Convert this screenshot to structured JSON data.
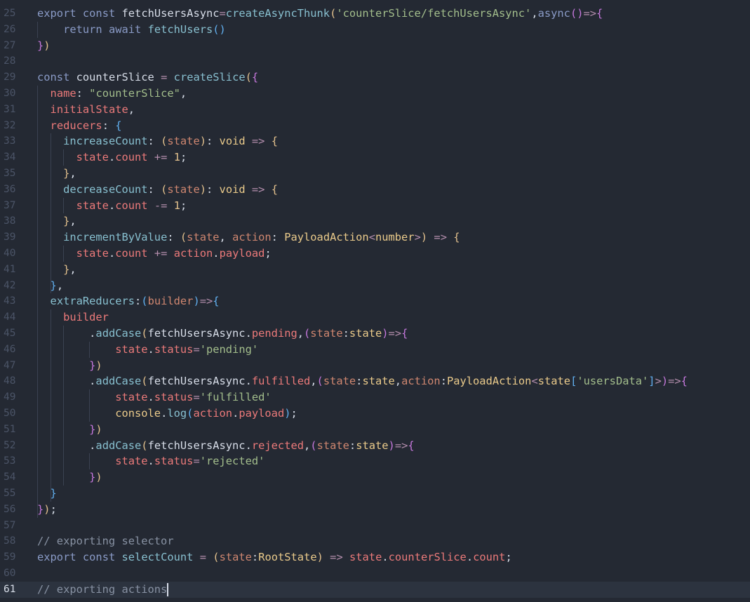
{
  "editor": {
    "current_line": 61,
    "lines": [
      {
        "n": "25",
        "tokens": [
          [
            "kw",
            "export"
          ],
          [
            "pu",
            " "
          ],
          [
            "kw",
            "const"
          ],
          [
            "pu",
            " "
          ],
          [
            "id",
            "fetchUsersAsync"
          ],
          [
            "op",
            "="
          ],
          [
            "fn",
            "createAsyncThunk"
          ],
          [
            "b1",
            "("
          ],
          [
            "st",
            "'counterSlice/fetchUsersAsync'"
          ],
          [
            "pu",
            ","
          ],
          [
            "kw",
            "async"
          ],
          [
            "b2",
            "()"
          ],
          [
            "op",
            "=>"
          ],
          [
            "b2",
            "{"
          ]
        ]
      },
      {
        "n": "26",
        "tokens": [
          [
            "pu",
            "    "
          ],
          [
            "kw",
            "return"
          ],
          [
            "pu",
            " "
          ],
          [
            "kw",
            "await"
          ],
          [
            "pu",
            " "
          ],
          [
            "fn",
            "fetchUsers"
          ],
          [
            "b3",
            "()"
          ]
        ]
      },
      {
        "n": "27",
        "tokens": [
          [
            "b2",
            "}"
          ],
          [
            "b1",
            ")"
          ]
        ]
      },
      {
        "n": "28",
        "tokens": []
      },
      {
        "n": "29",
        "tokens": [
          [
            "kw",
            "const"
          ],
          [
            "pu",
            " "
          ],
          [
            "id",
            "counterSlice"
          ],
          [
            "pu",
            " "
          ],
          [
            "op",
            "="
          ],
          [
            "pu",
            " "
          ],
          [
            "fn",
            "createSlice"
          ],
          [
            "b1",
            "("
          ],
          [
            "b2",
            "{"
          ]
        ]
      },
      {
        "n": "30",
        "tokens": [
          [
            "pu",
            "  "
          ],
          [
            "pr",
            "name"
          ],
          [
            "pu",
            ": "
          ],
          [
            "st",
            "\"counterSlice\""
          ],
          [
            "pu",
            ","
          ]
        ]
      },
      {
        "n": "31",
        "tokens": [
          [
            "pu",
            "  "
          ],
          [
            "pr",
            "initialState"
          ],
          [
            "pu",
            ","
          ]
        ]
      },
      {
        "n": "32",
        "tokens": [
          [
            "pu",
            "  "
          ],
          [
            "pr",
            "reducers"
          ],
          [
            "pu",
            ": "
          ],
          [
            "b3",
            "{"
          ]
        ]
      },
      {
        "n": "33",
        "tokens": [
          [
            "pu",
            "    "
          ],
          [
            "fn",
            "increaseCount"
          ],
          [
            "pu",
            ": "
          ],
          [
            "b1",
            "("
          ],
          [
            "pa",
            "state"
          ],
          [
            "b1",
            ")"
          ],
          [
            "pu",
            ": "
          ],
          [
            "ty",
            "void"
          ],
          [
            "pu",
            " "
          ],
          [
            "op",
            "=>"
          ],
          [
            "pu",
            " "
          ],
          [
            "b1",
            "{"
          ]
        ]
      },
      {
        "n": "34",
        "tokens": [
          [
            "pu",
            "      "
          ],
          [
            "pr",
            "state"
          ],
          [
            "pu",
            "."
          ],
          [
            "pr",
            "count"
          ],
          [
            "pu",
            " "
          ],
          [
            "op",
            "+="
          ],
          [
            "pu",
            " "
          ],
          [
            "nu",
            "1"
          ],
          [
            "pu",
            ";"
          ]
        ]
      },
      {
        "n": "35",
        "tokens": [
          [
            "pu",
            "    "
          ],
          [
            "b1",
            "}"
          ],
          [
            "pu",
            ","
          ]
        ]
      },
      {
        "n": "36",
        "tokens": [
          [
            "pu",
            "    "
          ],
          [
            "fn",
            "decreaseCount"
          ],
          [
            "pu",
            ": "
          ],
          [
            "b1",
            "("
          ],
          [
            "pa",
            "state"
          ],
          [
            "b1",
            ")"
          ],
          [
            "pu",
            ": "
          ],
          [
            "ty",
            "void"
          ],
          [
            "pu",
            " "
          ],
          [
            "op",
            "=>"
          ],
          [
            "pu",
            " "
          ],
          [
            "b1",
            "{"
          ]
        ]
      },
      {
        "n": "37",
        "tokens": [
          [
            "pu",
            "      "
          ],
          [
            "pr",
            "state"
          ],
          [
            "pu",
            "."
          ],
          [
            "pr",
            "count"
          ],
          [
            "pu",
            " "
          ],
          [
            "op",
            "-="
          ],
          [
            "pu",
            " "
          ],
          [
            "nu",
            "1"
          ],
          [
            "pu",
            ";"
          ]
        ]
      },
      {
        "n": "38",
        "tokens": [
          [
            "pu",
            "    "
          ],
          [
            "b1",
            "}"
          ],
          [
            "pu",
            ","
          ]
        ]
      },
      {
        "n": "39",
        "tokens": [
          [
            "pu",
            "    "
          ],
          [
            "fn",
            "incrementByValue"
          ],
          [
            "pu",
            ": "
          ],
          [
            "b1",
            "("
          ],
          [
            "pa",
            "state"
          ],
          [
            "pu",
            ", "
          ],
          [
            "pa",
            "action"
          ],
          [
            "pu",
            ": "
          ],
          [
            "ty",
            "PayloadAction"
          ],
          [
            "op",
            "<"
          ],
          [
            "ty",
            "number"
          ],
          [
            "op",
            ">"
          ],
          [
            "b1",
            ")"
          ],
          [
            "pu",
            " "
          ],
          [
            "op",
            "=>"
          ],
          [
            "pu",
            " "
          ],
          [
            "b1",
            "{"
          ]
        ]
      },
      {
        "n": "40",
        "tokens": [
          [
            "pu",
            "      "
          ],
          [
            "pr",
            "state"
          ],
          [
            "pu",
            "."
          ],
          [
            "pr",
            "count"
          ],
          [
            "pu",
            " "
          ],
          [
            "op",
            "+="
          ],
          [
            "pu",
            " "
          ],
          [
            "pr",
            "action"
          ],
          [
            "pu",
            "."
          ],
          [
            "pr",
            "payload"
          ],
          [
            "pu",
            ";"
          ]
        ]
      },
      {
        "n": "41",
        "tokens": [
          [
            "pu",
            "    "
          ],
          [
            "b1",
            "}"
          ],
          [
            "pu",
            ","
          ]
        ]
      },
      {
        "n": "42",
        "tokens": [
          [
            "pu",
            "  "
          ],
          [
            "b3",
            "}"
          ],
          [
            "pu",
            ","
          ]
        ]
      },
      {
        "n": "43",
        "tokens": [
          [
            "pu",
            "  "
          ],
          [
            "fn",
            "extraReducers"
          ],
          [
            "pu",
            ":"
          ],
          [
            "b3",
            "("
          ],
          [
            "pa",
            "builder"
          ],
          [
            "b3",
            ")"
          ],
          [
            "op",
            "=>"
          ],
          [
            "b3",
            "{"
          ]
        ]
      },
      {
        "n": "44",
        "tokens": [
          [
            "pu",
            "    "
          ],
          [
            "pr",
            "builder"
          ]
        ]
      },
      {
        "n": "45",
        "tokens": [
          [
            "pu",
            "        "
          ],
          [
            "pu",
            "."
          ],
          [
            "fn",
            "addCase"
          ],
          [
            "b1",
            "("
          ],
          [
            "id",
            "fetchUsersAsync"
          ],
          [
            "pu",
            "."
          ],
          [
            "pr",
            "pending"
          ],
          [
            "pu",
            ","
          ],
          [
            "b2",
            "("
          ],
          [
            "pa",
            "state"
          ],
          [
            "pu",
            ":"
          ],
          [
            "ty",
            "state"
          ],
          [
            "b2",
            ")"
          ],
          [
            "op",
            "=>"
          ],
          [
            "b2",
            "{"
          ]
        ]
      },
      {
        "n": "46",
        "tokens": [
          [
            "pu",
            "            "
          ],
          [
            "pr",
            "state"
          ],
          [
            "pu",
            "."
          ],
          [
            "pr",
            "status"
          ],
          [
            "op",
            "="
          ],
          [
            "st",
            "'pending'"
          ]
        ]
      },
      {
        "n": "47",
        "tokens": [
          [
            "pu",
            "        "
          ],
          [
            "b2",
            "}"
          ],
          [
            "b1",
            ")"
          ]
        ]
      },
      {
        "n": "48",
        "tokens": [
          [
            "pu",
            "        "
          ],
          [
            "pu",
            "."
          ],
          [
            "fn",
            "addCase"
          ],
          [
            "b1",
            "("
          ],
          [
            "id",
            "fetchUsersAsync"
          ],
          [
            "pu",
            "."
          ],
          [
            "pr",
            "fulfilled"
          ],
          [
            "pu",
            ","
          ],
          [
            "b2",
            "("
          ],
          [
            "pa",
            "state"
          ],
          [
            "pu",
            ":"
          ],
          [
            "ty",
            "state"
          ],
          [
            "pu",
            ","
          ],
          [
            "pa",
            "action"
          ],
          [
            "pu",
            ":"
          ],
          [
            "ty",
            "PayloadAction"
          ],
          [
            "op",
            "<"
          ],
          [
            "ty",
            "state"
          ],
          [
            "b3",
            "["
          ],
          [
            "st",
            "'usersData'"
          ],
          [
            "b3",
            "]"
          ],
          [
            "op",
            ">"
          ],
          [
            "b2",
            ")"
          ],
          [
            "op",
            "=>"
          ],
          [
            "b2",
            "{"
          ]
        ]
      },
      {
        "n": "49",
        "tokens": [
          [
            "pu",
            "            "
          ],
          [
            "pr",
            "state"
          ],
          [
            "pu",
            "."
          ],
          [
            "pr",
            "status"
          ],
          [
            "op",
            "="
          ],
          [
            "st",
            "'fulfilled'"
          ]
        ]
      },
      {
        "n": "50",
        "tokens": [
          [
            "pu",
            "            "
          ],
          [
            "ty",
            "console"
          ],
          [
            "pu",
            "."
          ],
          [
            "fn",
            "log"
          ],
          [
            "b3",
            "("
          ],
          [
            "pr",
            "action"
          ],
          [
            "pu",
            "."
          ],
          [
            "pr",
            "payload"
          ],
          [
            "b3",
            ")"
          ],
          [
            "pu",
            ";"
          ]
        ]
      },
      {
        "n": "51",
        "tokens": [
          [
            "pu",
            "        "
          ],
          [
            "b2",
            "}"
          ],
          [
            "b1",
            ")"
          ]
        ]
      },
      {
        "n": "52",
        "tokens": [
          [
            "pu",
            "        "
          ],
          [
            "pu",
            "."
          ],
          [
            "fn",
            "addCase"
          ],
          [
            "b1",
            "("
          ],
          [
            "id",
            "fetchUsersAsync"
          ],
          [
            "pu",
            "."
          ],
          [
            "pr",
            "rejected"
          ],
          [
            "pu",
            ","
          ],
          [
            "b2",
            "("
          ],
          [
            "pa",
            "state"
          ],
          [
            "pu",
            ":"
          ],
          [
            "ty",
            "state"
          ],
          [
            "b2",
            ")"
          ],
          [
            "op",
            "=>"
          ],
          [
            "b2",
            "{"
          ]
        ]
      },
      {
        "n": "53",
        "tokens": [
          [
            "pu",
            "            "
          ],
          [
            "pr",
            "state"
          ],
          [
            "pu",
            "."
          ],
          [
            "pr",
            "status"
          ],
          [
            "op",
            "="
          ],
          [
            "st",
            "'rejected'"
          ]
        ]
      },
      {
        "n": "54",
        "tokens": [
          [
            "pu",
            "        "
          ],
          [
            "b2",
            "}"
          ],
          [
            "b1",
            ")"
          ]
        ]
      },
      {
        "n": "55",
        "tokens": [
          [
            "pu",
            "  "
          ],
          [
            "b3",
            "}"
          ]
        ]
      },
      {
        "n": "56",
        "tokens": [
          [
            "b2",
            "}"
          ],
          [
            "b1",
            ")"
          ],
          [
            "pu",
            ";"
          ]
        ]
      },
      {
        "n": "57",
        "tokens": []
      },
      {
        "n": "58",
        "tokens": [
          [
            "cm",
            "// exporting selector"
          ]
        ]
      },
      {
        "n": "59",
        "tokens": [
          [
            "kw",
            "export"
          ],
          [
            "pu",
            " "
          ],
          [
            "kw",
            "const"
          ],
          [
            "pu",
            " "
          ],
          [
            "fn",
            "selectCount"
          ],
          [
            "pu",
            " "
          ],
          [
            "op",
            "="
          ],
          [
            "pu",
            " "
          ],
          [
            "b1",
            "("
          ],
          [
            "pa",
            "state"
          ],
          [
            "pu",
            ":"
          ],
          [
            "ty",
            "RootState"
          ],
          [
            "b1",
            ")"
          ],
          [
            "pu",
            " "
          ],
          [
            "op",
            "=>"
          ],
          [
            "pu",
            " "
          ],
          [
            "pr",
            "state"
          ],
          [
            "pu",
            "."
          ],
          [
            "pr",
            "counterSlice"
          ],
          [
            "pu",
            "."
          ],
          [
            "pr",
            "count"
          ],
          [
            "pu",
            ";"
          ]
        ]
      },
      {
        "n": "60",
        "tokens": []
      },
      {
        "n": "61",
        "tokens": [
          [
            "cm",
            "// exporting actions"
          ]
        ]
      }
    ]
  }
}
